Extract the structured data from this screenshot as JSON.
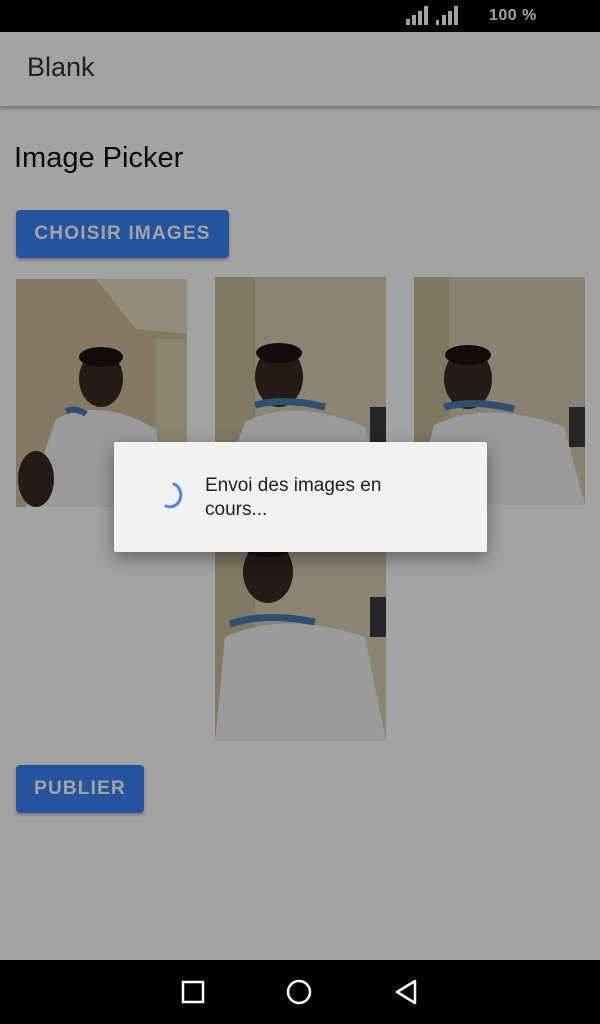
{
  "status_bar": {
    "battery": "100 %",
    "icons": [
      "signal-icon",
      "signal-icon"
    ]
  },
  "app_bar": {
    "title": "Blank"
  },
  "page": {
    "heading": "Image Picker"
  },
  "buttons": {
    "choose_images": "CHOISIR IMAGES",
    "publish": "PUBLIER"
  },
  "images": [
    {
      "name": "selected-image-1"
    },
    {
      "name": "selected-image-2"
    },
    {
      "name": "selected-image-3"
    },
    {
      "name": "selected-image-4"
    }
  ],
  "dialog": {
    "message": "Envoi des images en cours...",
    "icon": "spinner-icon"
  },
  "nav_bar": {
    "icons": [
      "recents-icon",
      "home-icon",
      "back-icon"
    ]
  },
  "colors": {
    "accent": "#3b82f6",
    "scrim": "rgba(0,0,0,0.36)",
    "dialog_bg": "#f2f2f2"
  }
}
